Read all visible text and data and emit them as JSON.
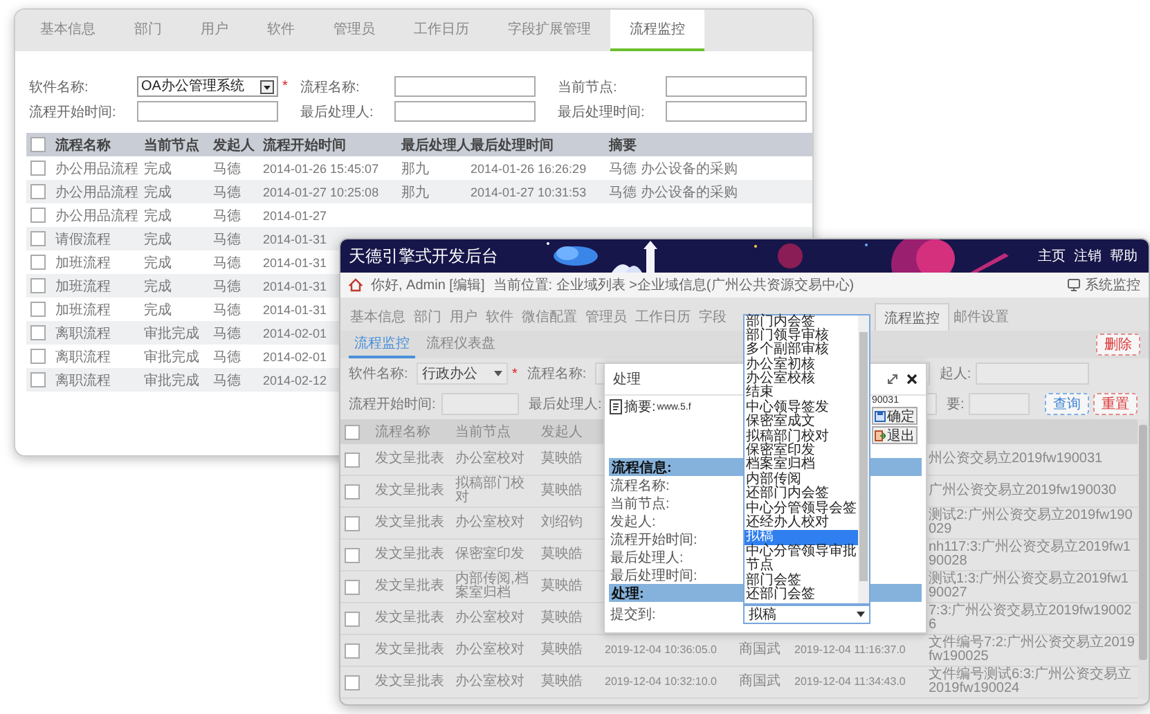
{
  "back_window": {
    "tabs": [
      {
        "label": "基本信息",
        "selected": false
      },
      {
        "label": "部门",
        "selected": false
      },
      {
        "label": "用户",
        "selected": false
      },
      {
        "label": "软件",
        "selected": false
      },
      {
        "label": "管理员",
        "selected": false
      },
      {
        "label": "工作日历",
        "selected": false
      },
      {
        "label": "字段扩展管理",
        "selected": false
      },
      {
        "label": "流程监控",
        "selected": true
      }
    ],
    "form": [
      {
        "label": "软件名称:",
        "kind": "select",
        "value": "OA办公管理系统",
        "required_mark": "*"
      },
      {
        "label": "流程名称:",
        "kind": "text"
      },
      {
        "label": "当前节点:",
        "kind": "text"
      },
      {
        "label": "流程开始时间:",
        "kind": "text"
      },
      {
        "label": "最后处理人:",
        "kind": "text"
      },
      {
        "label": "最后处理时间:",
        "kind": "text"
      }
    ],
    "table": {
      "all_checked": false,
      "columns": [
        "流程名称",
        "当前节点",
        "发起人",
        "流程开始时间",
        "最后处理人",
        "最后处理时间",
        "摘要"
      ],
      "rows": [
        {
          "checked": false,
          "cells": [
            "办公用品流程",
            "完成",
            "马德",
            "2014-01-26 15:45:07",
            "那九",
            "2014-01-26 16:26:29",
            "马德 办公设备的采购"
          ]
        },
        {
          "checked": false,
          "cells": [
            "办公用品流程",
            "完成",
            "马德",
            "2014-01-27 10:25:08",
            "那九",
            "2014-01-27 10:31:53",
            "马德 办公设备的采购"
          ]
        },
        {
          "checked": false,
          "cells": [
            "办公用品流程",
            "完成",
            "马德",
            "2014-01-27"
          ]
        },
        {
          "checked": false,
          "cells": [
            "请假流程",
            "完成",
            "马德",
            "2014-01-31"
          ]
        },
        {
          "checked": false,
          "cells": [
            "加班流程",
            "完成",
            "马德",
            "2014-01-31"
          ]
        },
        {
          "checked": false,
          "cells": [
            "加班流程",
            "完成",
            "马德",
            "2014-01-31"
          ]
        },
        {
          "checked": false,
          "cells": [
            "加班流程",
            "完成",
            "马德",
            "2014-01-31"
          ]
        },
        {
          "checked": false,
          "cells": [
            "离职流程",
            "审批完成",
            "马德",
            "2014-02-01"
          ]
        },
        {
          "checked": false,
          "cells": [
            "离职流程",
            "审批完成",
            "马德",
            "2014-02-01"
          ]
        },
        {
          "checked": false,
          "cells": [
            "离职流程",
            "审批完成",
            "马德",
            "2014-02-12"
          ]
        }
      ]
    }
  },
  "front_window": {
    "title": "天德引擎式开发后台",
    "header_links": [
      "主页",
      "注销",
      "帮助"
    ],
    "greeting": "你好, Admin [编辑]",
    "location": "当前位置: 企业域列表 >企业域信息(广州公共资源交易中心)",
    "monitor_link": "系统监控",
    "tabs": [
      {
        "label": "基本信息",
        "selected": false
      },
      {
        "label": "部门",
        "selected": false
      },
      {
        "label": "用户",
        "selected": false
      },
      {
        "label": "软件",
        "selected": false
      },
      {
        "label": "微信配置",
        "selected": false
      },
      {
        "label": "管理员",
        "selected": false
      },
      {
        "label": "工作日历",
        "selected": false
      },
      {
        "label": "字段",
        "selected": false
      },
      {
        "label": "流程监控",
        "selected": true
      },
      {
        "label": "邮件设置",
        "selected": false
      }
    ],
    "subtabs": [
      {
        "label": "流程监控",
        "selected": true
      },
      {
        "label": "流程仪表盘",
        "selected": false
      }
    ],
    "delete_button": "删除",
    "form": [
      {
        "label": "软件名称:",
        "kind": "select",
        "value": "行政办公",
        "required_mark": "*"
      },
      {
        "label": "流程名称:",
        "kind": "text"
      },
      {
        "label": "起人:",
        "kind": "text"
      },
      {
        "label": "流程开始时间:",
        "kind": "text"
      },
      {
        "label": "最后处理人:",
        "kind": "text"
      },
      {
        "label": "要:",
        "kind": "text"
      }
    ],
    "query_button": "查询",
    "reset_button": "重置",
    "table": {
      "all_checked": false,
      "columns": [
        "流程名称",
        "当前节点",
        "发起人"
      ],
      "rows": [
        {
          "checked": false,
          "name": "发文呈批表",
          "node": "办公室校对",
          "starter": "莫映皓",
          "summary": "州公资交易立2019fw190031"
        },
        {
          "checked": false,
          "name": "发文呈批表",
          "node": "拟稿部门校对",
          "starter": "莫映皓",
          "summary": "广州公资交易立2019fw190030"
        },
        {
          "checked": false,
          "name": "发文呈批表",
          "node": "办公室校对",
          "starter": "刘绍钧",
          "summary": "测试2:广州公资交易立2019fw190029"
        },
        {
          "checked": false,
          "name": "发文呈批表",
          "node": "保密室印发",
          "starter": "莫映皓",
          "summary": "nh117:3:广州公资交易立2019fw190028"
        },
        {
          "checked": false,
          "name": "发文呈批表",
          "node": "内部传阅,档案室归档",
          "starter": "莫映皓",
          "summary": "测试1:3:广州公资交易立2019fw190027"
        },
        {
          "checked": false,
          "name": "发文呈批表",
          "node": "办公室校对",
          "starter": "莫映皓",
          "summary": "7:3:广州公资交易立2019fw190026"
        },
        {
          "checked": false,
          "name": "发文呈批表",
          "node": "办公室校对",
          "starter": "莫映皓",
          "start_time": "2019-12-04 10:36:05.0",
          "last_handler": "商国武",
          "last_time": "2019-12-04 11:16:37.0",
          "summary": "文件编号7:2:广州公资交易立2019fw190025"
        },
        {
          "checked": false,
          "name": "发文呈批表",
          "node": "办公室校对",
          "starter": "莫映皓",
          "start_time": "2019-12-04 10:32:10.0",
          "last_handler": "商国武",
          "last_time": "2019-12-04 11:34:43.0",
          "summary": "文件编号测试6:3:广州公资交易立2019fw190024"
        }
      ]
    },
    "dialog": {
      "title": "处理",
      "summary_label": "摘要:",
      "summary_start": "www.5.f",
      "summary_end": "90031",
      "ok_button": "确定",
      "exit_button": "退出",
      "info_section": "流程信息:",
      "info_labels": [
        "流程名称:",
        "当前节点:",
        "发起人:",
        "流程开始时间:",
        "最后处理人:",
        "最后处理时间:"
      ],
      "handle_section": "处理:",
      "submit_label": "提交到:",
      "submit_value": "拟稿",
      "options": [
        {
          "label": "部门内会签",
          "selected": false
        },
        {
          "label": "部门领导审核",
          "selected": false
        },
        {
          "label": "多个副部审核",
          "selected": false
        },
        {
          "label": "办公室初核",
          "selected": false
        },
        {
          "label": "办公室校核",
          "selected": false
        },
        {
          "label": "结束",
          "selected": false
        },
        {
          "label": "中心领导签发",
          "selected": false
        },
        {
          "label": "保密室成文",
          "selected": false
        },
        {
          "label": "拟稿部门校对",
          "selected": false
        },
        {
          "label": "保密室印发",
          "selected": false
        },
        {
          "label": "档案室归档",
          "selected": false
        },
        {
          "label": "内部传阅",
          "selected": false
        },
        {
          "label": "还部门内会签",
          "selected": false
        },
        {
          "label": "中心分管领导会签",
          "selected": false
        },
        {
          "label": "还经办人校对",
          "selected": false
        },
        {
          "label": "拟稿",
          "selected": true
        },
        {
          "label": "中心分管领导审批",
          "selected": false
        },
        {
          "label": "节点",
          "selected": false
        },
        {
          "label": "部门会签",
          "selected": false
        },
        {
          "label": "还部门会签",
          "selected": false
        }
      ]
    }
  }
}
